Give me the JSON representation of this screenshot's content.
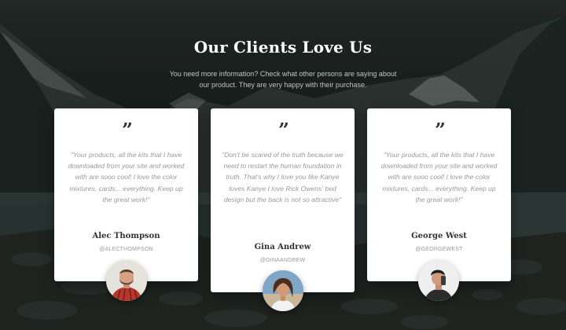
{
  "section": {
    "title": "Our Clients Love Us",
    "subtitle": "You need more information? Check what other persons are saying about our product. They are very happy with their purchase."
  },
  "quote_icon": "quote-icon",
  "testimonials": [
    {
      "quote": "\"Your products, all the kits that I have downloaded from your site and worked with are sooo cool! I love the color mixtures, cards... everything. Keep up the great work!\"",
      "name": "Alec Thompson",
      "handle": "@ALECTHOMPSON"
    },
    {
      "quote": "\"Don't be scared of the truth because we need to restart the human foundation in truth. That's why I love you like Kanye loves Kanye I love Rick Owens' bed design but the back is not so attractive\"",
      "name": "Gina Andrew",
      "handle": "@GINAANDREW"
    },
    {
      "quote": "\"Your products, all the kits that I have downloaded from your site and worked with are sooo cool! I love the color mixtures, cards... everything. Keep up the great work!\"",
      "name": "George West",
      "handle": "@GEORGEWEST"
    }
  ],
  "colors": {
    "card": "#ffffff",
    "heading": "#333333",
    "muted_text": "#9a9a9a"
  }
}
